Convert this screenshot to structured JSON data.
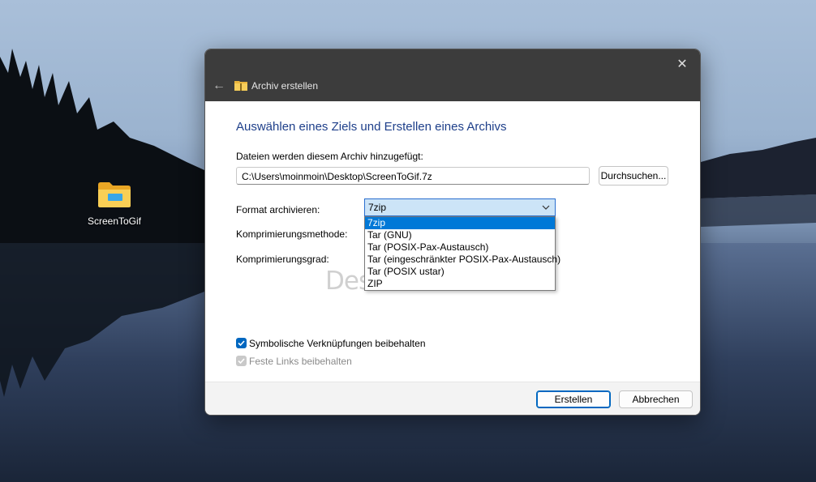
{
  "desktop": {
    "icon_label": "ScreenToGif"
  },
  "dialog": {
    "title": "Archiv erstellen",
    "heading": "Auswählen eines Ziels und Erstellen eines Archivs",
    "files_label": "Dateien werden diesem Archiv hinzugefügt:",
    "path_value": "C:\\Users\\moinmoin\\Desktop\\ScreenToGif.7z",
    "browse_label": "Durchsuchen...",
    "format_label": "Format archivieren:",
    "format_selected": "7zip",
    "format_options": [
      "7zip",
      "Tar (GNU)",
      "Tar (POSIX-Pax-Austausch)",
      "Tar (eingeschränkter POSIX-Pax-Austausch)",
      "Tar (POSIX ustar)",
      "ZIP"
    ],
    "method_label": "Komprimierungsmethode:",
    "level_label": "Komprimierungsgrad:",
    "symlinks_label": "Symbolische Verknüpfungen beibehalten",
    "symlinks_checked": true,
    "hardlinks_label": "Feste Links beibehalten",
    "hardlinks_checked": true,
    "create_button": "Erstellen",
    "cancel_button": "Abbrechen",
    "watermark": "Deskmodder.de"
  },
  "colors": {
    "accent": "#0067c0",
    "heading": "#1e3f8a",
    "titlebar": "#3c3c3c"
  },
  "icons": [
    "folder-icon",
    "close-icon",
    "back-arrow-icon",
    "zip-folder-icon",
    "chevron-down-icon",
    "checkmark-icon"
  ]
}
